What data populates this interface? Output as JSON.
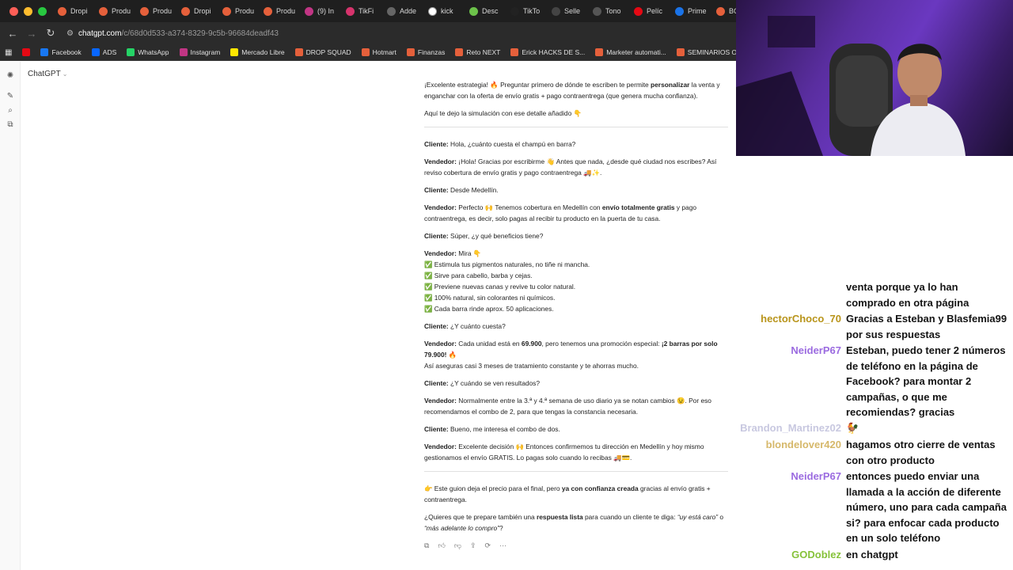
{
  "colors": {
    "traffic": [
      "#ff5f57",
      "#febc2e",
      "#28c840"
    ],
    "overlay_user_primary": "#b8941a",
    "overlay_user_alt": "#9b6be0",
    "overlay_user_green": "#86c23a"
  },
  "tabs": [
    {
      "label": "Dropi",
      "icon": "circle-icon",
      "color": "#e5603b"
    },
    {
      "label": "Produ",
      "icon": "circle-icon",
      "color": "#e5603b"
    },
    {
      "label": "Produ",
      "icon": "circle-icon",
      "color": "#e5603b"
    },
    {
      "label": "Dropi",
      "icon": "circle-icon",
      "color": "#e5603b"
    },
    {
      "label": "Produ",
      "icon": "circle-icon",
      "color": "#e5603b"
    },
    {
      "label": "Produ",
      "icon": "circle-icon",
      "color": "#e5603b"
    },
    {
      "label": "(9) In",
      "icon": "instagram-icon",
      "color": "#c13584"
    },
    {
      "label": "TikFi",
      "icon": "tikfinity-icon",
      "color": "#d6336c"
    },
    {
      "label": "Adde",
      "icon": "puzzle-icon",
      "color": "#666666"
    },
    {
      "label": "kick",
      "icon": "google-icon",
      "color": "#ffffff"
    },
    {
      "label": "Desc",
      "icon": "download-icon",
      "color": "#6cc24a"
    },
    {
      "label": "TikTo",
      "icon": "tiktok-icon",
      "color": "#222222"
    },
    {
      "label": "Selle",
      "icon": "seller-icon",
      "color": "#444444"
    },
    {
      "label": "Tono",
      "icon": "globe-icon",
      "color": "#555555"
    },
    {
      "label": "Pelíc",
      "icon": "netflix-icon",
      "color": "#e50914"
    },
    {
      "label": "Prime",
      "icon": "play-icon",
      "color": "#1a73e8"
    },
    {
      "label": "BOF",
      "icon": "circle-icon",
      "color": "#e5603b"
    }
  ],
  "address": {
    "host": "chatgpt.com",
    "path": "/c/68d0d533-a374-8329-9c5b-96684deadf43"
  },
  "bookmarks": [
    {
      "label": "",
      "icon": "netflix-icon",
      "color": "#e50914"
    },
    {
      "label": "Facebook",
      "icon": "facebook-icon",
      "color": "#1877f2"
    },
    {
      "label": "ADS",
      "icon": "meta-icon",
      "color": "#0866ff"
    },
    {
      "label": "WhatsApp",
      "icon": "whatsapp-icon",
      "color": "#25d366"
    },
    {
      "label": "Instagram",
      "icon": "instagram-icon",
      "color": "#c13584"
    },
    {
      "label": "Mercado Libre",
      "icon": "mercadolibre-icon",
      "color": "#ffe600"
    },
    {
      "label": "DROP SQUAD",
      "icon": "flame-icon",
      "color": "#e5603b"
    },
    {
      "label": "Hotmart",
      "icon": "flame-icon",
      "color": "#e5603b"
    },
    {
      "label": "Finanzas",
      "icon": "flame-icon",
      "color": "#e5603b"
    },
    {
      "label": "Reto NEXT",
      "icon": "flame-icon",
      "color": "#e5603b"
    },
    {
      "label": "Erick HACKS DE S...",
      "icon": "flame-icon",
      "color": "#e5603b"
    },
    {
      "label": "Marketer automati...",
      "icon": "flame-icon",
      "color": "#e5603b"
    },
    {
      "label": "SEMINARIOS ONLI...",
      "icon": "flame-icon",
      "color": "#e5603b"
    }
  ],
  "app": {
    "model": "ChatGPT"
  },
  "chat": {
    "intro1": "¡Excelente estrategia! 🔥 Preguntar primero de dónde te escriben te permite ",
    "intro1_bold": "personalizar",
    "intro1_end": " la venta y enganchar con la oferta de envío gratis + pago contraentrega (que genera mucha confianza).",
    "intro2": "Aquí te dejo la simulación con ese detalle añadido 👇",
    "lines": [
      {
        "speaker": "Cliente:",
        "text": " Hola, ¿cuánto cuesta el champú en barra?"
      },
      {
        "speaker": "Vendedor:",
        "text": " ¡Hola! Gracias por escribirme 👋 Antes que nada, ¿desde qué ciudad nos escribes? Así reviso cobertura de envío gratis y pago contraentrega 🚚✨."
      },
      {
        "speaker": "Cliente:",
        "text": " Desde Medellín."
      }
    ],
    "v2_speaker": "Vendedor:",
    "v2_a": " Perfecto 🙌 Tenemos cobertura en Medellín con ",
    "v2_bold": "envío totalmente gratis",
    "v2_b": " y pago contraentrega, es decir, solo pagas al recibir tu producto en la puerta de tu casa.",
    "c3_speaker": "Cliente:",
    "c3_text": " Súper, ¿y qué beneficios tiene?",
    "v3_speaker": "Vendedor:",
    "v3_text": " Mira 👇",
    "benefits": [
      "✅ Estimula tus pigmentos naturales, no tiñe ni mancha.",
      "✅ Sirve para cabello, barba y cejas.",
      "✅ Previene nuevas canas y revive tu color natural.",
      "✅ 100% natural, sin colorantes ni químicos.",
      "✅ Cada barra rinde aprox. 50 aplicaciones."
    ],
    "c4_speaker": "Cliente:",
    "c4_text": " ¿Y cuánto cuesta?",
    "v4_speaker": "Vendedor:",
    "v4_a": " Cada unidad está en ",
    "v4_price": "69.900",
    "v4_b": ", pero tenemos una promoción especial: ",
    "v4_promo": "¡2 barras por solo 79.900!",
    "v4_c": " 🔥",
    "v4_line2": "Así aseguras casi 3 meses de tratamiento constante y te ahorras mucho.",
    "c5_speaker": "Cliente:",
    "c5_text": " ¿Y cuándo se ven resultados?",
    "v5_speaker": "Vendedor:",
    "v5_text": " Normalmente entre la 3.ª y 4.ª semana de uso diario ya se notan cambios 😉. Por eso recomendamos el combo de 2, para que tengas la constancia necesaria.",
    "c6_speaker": "Cliente:",
    "c6_text": " Bueno, me interesa el combo de dos.",
    "v6_speaker": "Vendedor:",
    "v6_text": " Excelente decisión 🙌 Entonces confirmemos tu dirección en Medellín y hoy mismo gestionamos el envío GRATIS. Lo pagas solo cuando lo recibas 🚚💳.",
    "outro1_a": "👉 Este guion deja el precio para el final, pero ",
    "outro1_bold": "ya con confianza creada",
    "outro1_b": " gracias al envío gratis + contraentrega.",
    "outro2_a": "¿Quieres que te prepare también una ",
    "outro2_bold": "respuesta lista",
    "outro2_b": " para cuando un cliente te diga: ",
    "outro2_q1": "“uy está caro”",
    "outro2_mid": " o ",
    "outro2_q2": "“más adelante lo compro”",
    "outro2_end": "?"
  },
  "stream_chat": [
    {
      "user": "",
      "text": "venta porque ya lo han comprado en otra página",
      "color": "#b8941a"
    },
    {
      "user": "hectorChoco_70",
      "text": "Gracias a Esteban y Blasfemia99 por sus respuestas",
      "color": "#b8941a"
    },
    {
      "user": "NeiderP67",
      "text": "Esteban, puedo tener 2 números de teléfono en la página de Facebook? para montar 2 campañas, o que me recomiendas? gracias",
      "color": "#9b6be0"
    },
    {
      "user": "Brandon_Martinez02",
      "text": "🐓",
      "color": "#c8c8e0"
    },
    {
      "user": "blondelover420",
      "text": "hagamos otro cierre de ventas con otro producto",
      "color": "#d6b86a"
    },
    {
      "user": "NeiderP67",
      "text": "entonces puedo enviar una llamada a la acción de diferente número, uno para cada campaña si? para enfocar cada producto en un solo teléfono",
      "color": "#9b6be0"
    },
    {
      "user": "GODoblez",
      "text": "en chatgpt",
      "color": "#86c23a"
    }
  ]
}
